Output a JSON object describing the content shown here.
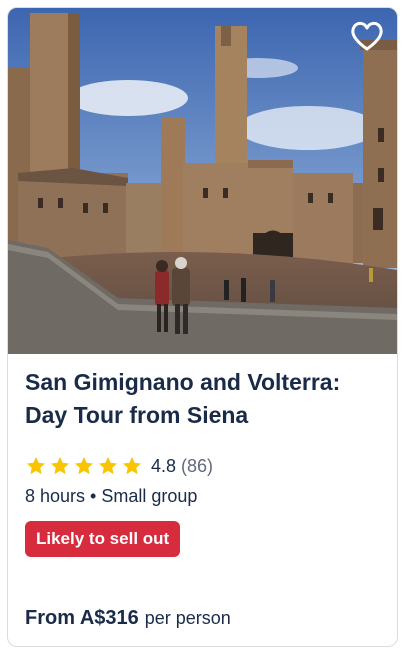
{
  "card": {
    "image": {
      "alt_subject": "piazza-towers-photo",
      "colors": {
        "sky": "#5f86c2",
        "stone": "#9a7a5a",
        "ground": "#8a6e5a"
      }
    },
    "wishlist_icon": "heart-outline-icon",
    "title": "San Gimignano and Volterra: Day Tour from Siena",
    "rating": {
      "value": "4.8",
      "count": "(86)",
      "stars": 5,
      "star_color": "#fbc400"
    },
    "meta": "8 hours • Small group",
    "badge": {
      "label": "Likely to sell out",
      "color": "#d72b3e"
    },
    "price": {
      "from_label": "From A$316",
      "per_label": "per person"
    }
  }
}
